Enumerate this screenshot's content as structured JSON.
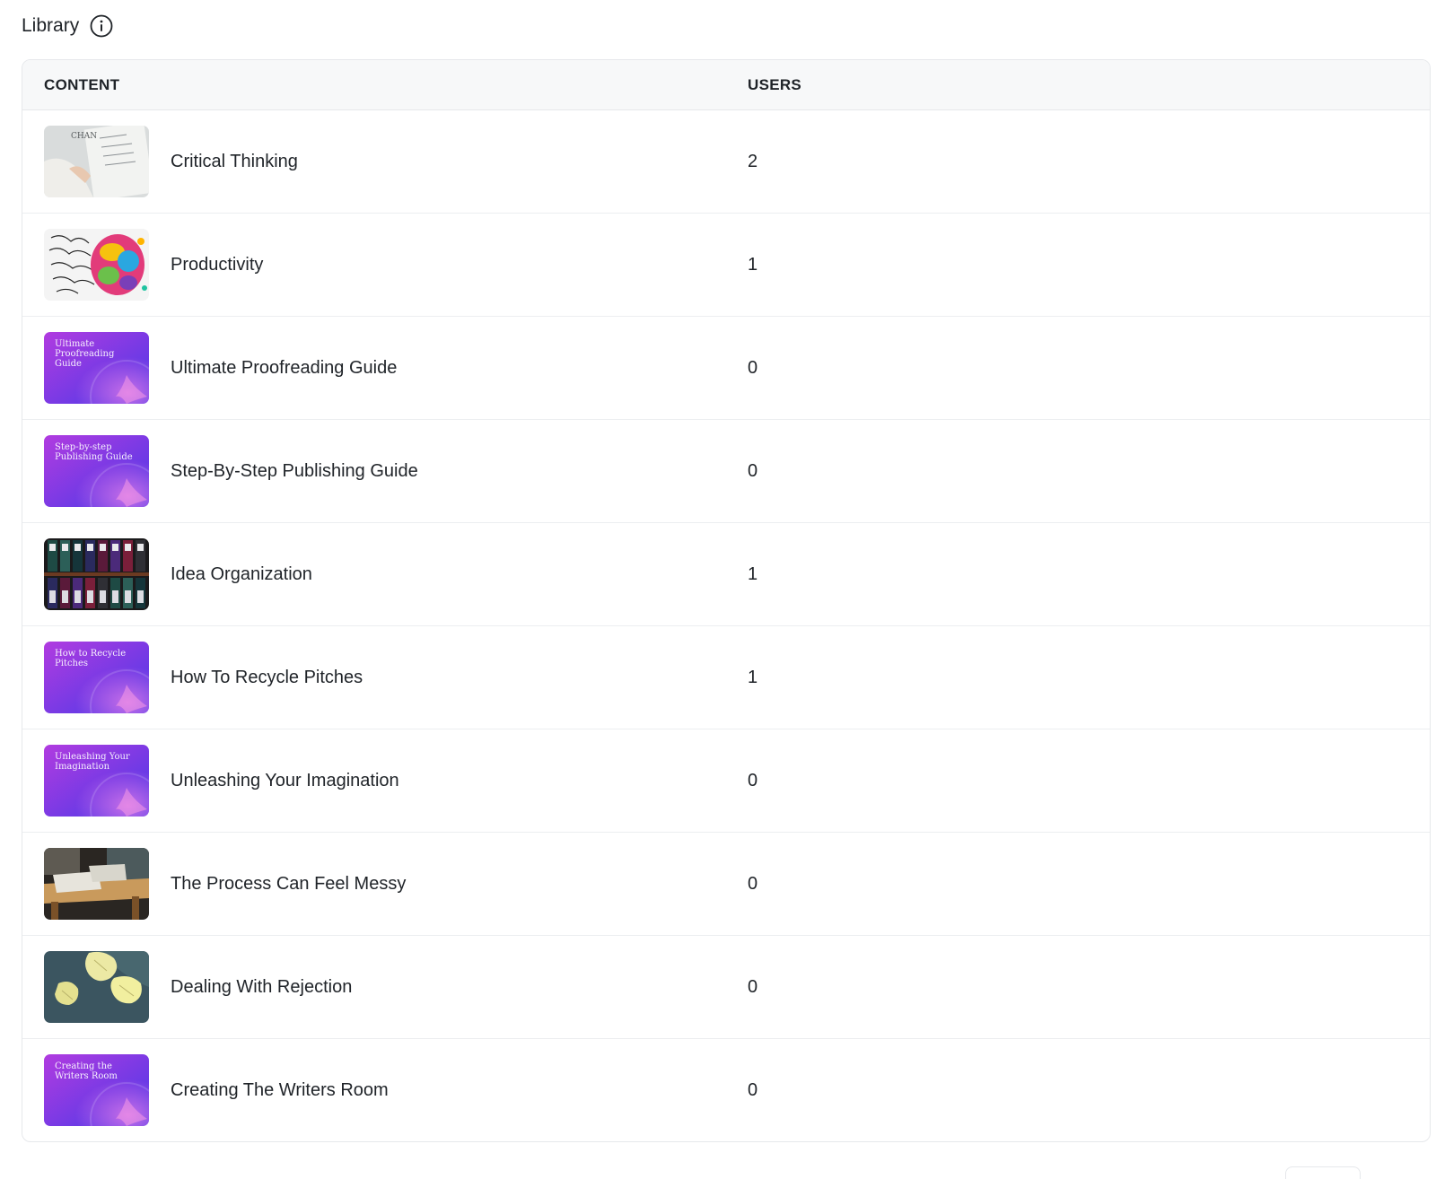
{
  "header": {
    "title": "Library"
  },
  "table": {
    "columns": {
      "content": "CONTENT",
      "users": "USERS"
    },
    "rows": [
      {
        "name": "Critical Thinking",
        "users": "2",
        "thumb": "photo-paper"
      },
      {
        "name": "Productivity",
        "users": "1",
        "thumb": "photo-brain"
      },
      {
        "name": "Ultimate Proofreading Guide",
        "users": "0",
        "thumb": "gradient",
        "thumb_text": "Ultimate Proofreading Guide"
      },
      {
        "name": "Step-By-Step Publishing Guide",
        "users": "0",
        "thumb": "gradient",
        "thumb_text": "Step-by-step Publishing Guide"
      },
      {
        "name": "Idea Organization",
        "users": "1",
        "thumb": "photo-binders"
      },
      {
        "name": "How To Recycle Pitches",
        "users": "1",
        "thumb": "gradient",
        "thumb_text": "How to Recycle Pitches"
      },
      {
        "name": "Unleashing Your Imagination",
        "users": "0",
        "thumb": "gradient",
        "thumb_text": "Unleashing Your Imagination"
      },
      {
        "name": "The Process Can Feel Messy",
        "users": "0",
        "thumb": "photo-desk"
      },
      {
        "name": "Dealing With Rejection",
        "users": "0",
        "thumb": "photo-crumpled"
      },
      {
        "name": "Creating The Writers Room",
        "users": "0",
        "thumb": "gradient",
        "thumb_text": "Creating the Writers Room"
      }
    ]
  },
  "colors": {
    "gradient_start": "#b13be0",
    "gradient_end": "#4a3ae8",
    "header_bg": "#f7f8f9",
    "border": "#e6e8eb"
  },
  "icons": {
    "info": "info-circle-icon"
  }
}
